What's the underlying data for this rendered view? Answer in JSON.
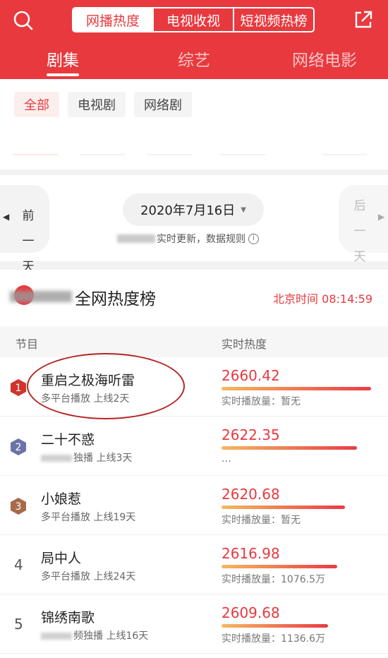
{
  "header": {
    "top_tabs": [
      "网播热度",
      "电视收视",
      "短视频热榜"
    ],
    "sub_tabs": [
      "剧集",
      "综艺",
      "网络电影"
    ]
  },
  "filters": [
    "全部",
    "电视剧",
    "网络剧"
  ],
  "date_nav": {
    "prev_label": [
      "前",
      "一",
      "天"
    ],
    "next_label": [
      "后",
      "一",
      "天"
    ],
    "date": "2020年7月16日",
    "note": "实时更新，数据规则"
  },
  "ranking": {
    "title": "全网热度榜",
    "beijing_time": "北京时间 08:14:59",
    "col_program": "节目",
    "col_heat": "实时热度",
    "rows": [
      {
        "rank": "1",
        "name": "重启之极海听雷",
        "meta": "多平台播放  上线2天",
        "heat": "2660.42",
        "bar": 1.0,
        "play": "实时播放量：暂无"
      },
      {
        "rank": "2",
        "name": "二十不惑",
        "meta": "独播  上线3天",
        "heat": "2622.35",
        "bar": 0.905,
        "play": "…"
      },
      {
        "rank": "3",
        "name": "小娘惹",
        "meta": "多平台播放  上线19天",
        "heat": "2620.68",
        "bar": 0.825,
        "play": "实时播放量：暂无"
      },
      {
        "rank": "4",
        "name": "局中人",
        "meta": "多平台播放  上线24天",
        "heat": "2616.98",
        "bar": 0.774,
        "play": "实时播放量：1076.5万"
      },
      {
        "rank": "5",
        "name": "锦绣南歌",
        "meta": "频独播  上线16天",
        "heat": "2609.68",
        "bar": 0.713,
        "play": "实时播放量：1136.6万"
      }
    ]
  },
  "colors": {
    "brand_red": "#e8393e",
    "gold": "#d0342c",
    "silver": "#6b74a8",
    "bronze": "#a86a4a"
  }
}
